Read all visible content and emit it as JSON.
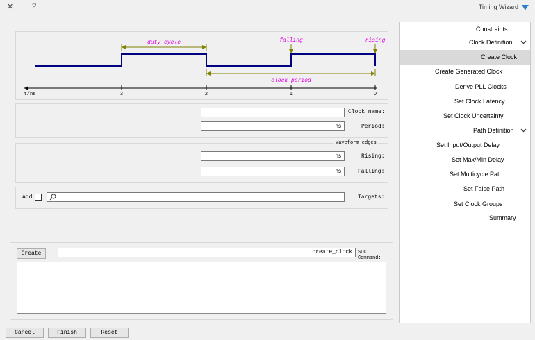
{
  "window": {
    "title": "Timing Wizard",
    "help": "?",
    "close": "✕"
  },
  "diagram": {
    "labels": {
      "duty_cycle": "duty cycle",
      "falling": "falling",
      "rising": "rising",
      "clock_period": "clock period"
    },
    "axis": {
      "unit": "t/ns",
      "ticks": [
        "3",
        "2",
        "1",
        "0"
      ]
    }
  },
  "form": {
    "clock_name": {
      "label": "Clock name:",
      "value": ""
    },
    "period": {
      "label": "Period:",
      "unit": "ns"
    },
    "waveform": {
      "title": "Waveform edges",
      "rising_label": "Rising:",
      "rising_unit": "ns",
      "falling_label": "Falling:",
      "falling_unit": "ns"
    },
    "targets": {
      "label": "Targets:",
      "value": "",
      "add_label": "Add"
    },
    "sdc": {
      "label": "SDC Command:",
      "value": "create_clock",
      "create_button": "Create"
    },
    "buttons": {
      "cancel": "Cancel",
      "finish": "Finish",
      "reset": "Reset"
    }
  },
  "nav": {
    "root": "Constraints",
    "clock_definition": "Clock Definition",
    "clock_items": [
      "Create Clock",
      "Create Generated Clock",
      "Derive PLL Clocks",
      "Set Clock Latency",
      "Set Clock Uncertainty"
    ],
    "path_definition": "Path Definition",
    "path_items": [
      "Set Input/Output Delay",
      "Set Max/Min Delay",
      "Set Multicycle Path",
      "Set False Path",
      "Set Clock Groups"
    ],
    "summary": "Summary"
  },
  "colors": {
    "waveform": "#000080",
    "annotation_olive": "#808000",
    "annotation_magenta": "#e000e0",
    "selection": "#d9d9d9"
  }
}
